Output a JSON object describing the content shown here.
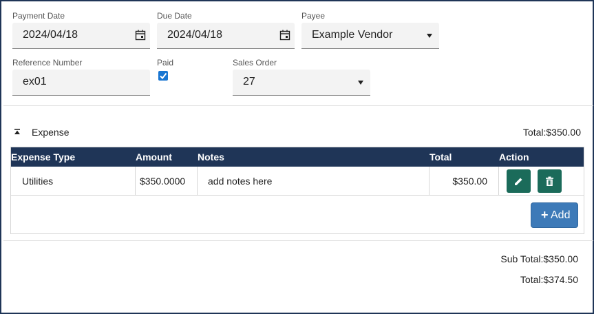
{
  "form": {
    "payment_date": {
      "label": "Payment Date",
      "value": "2024/04/18",
      "icon": "calendar-icon"
    },
    "due_date": {
      "label": "Due Date",
      "value": "2024/04/18",
      "icon": "calendar-icon"
    },
    "payee": {
      "label": "Payee",
      "value": "Example Vendor"
    },
    "reference_number": {
      "label": "Reference Number",
      "value": "ex01"
    },
    "paid": {
      "label": "Paid",
      "checked": true
    },
    "sales_order": {
      "label": "Sales Order",
      "value": "27"
    }
  },
  "expense_section": {
    "title": "Expense",
    "total": "Total:$350.00",
    "collapse_icon": "collapse-up-icon",
    "columns": [
      "Expense Type",
      "Amount",
      "Notes",
      "Total",
      "Action"
    ],
    "rows": [
      {
        "expense_type": "Utilities",
        "amount": "$350.0000",
        "notes": "add notes here",
        "total": "$350.00"
      }
    ],
    "add_button": {
      "label": "Add",
      "icon": "plus-icon"
    }
  },
  "summary": {
    "sub_total": "Sub Total:$350.00",
    "total": "Total:$374.50"
  },
  "colors": {
    "header_bg": "#1f3557",
    "action_button": "#1b6b5a",
    "add_button": "#3d7ab8",
    "checkbox": "#1976d2"
  }
}
